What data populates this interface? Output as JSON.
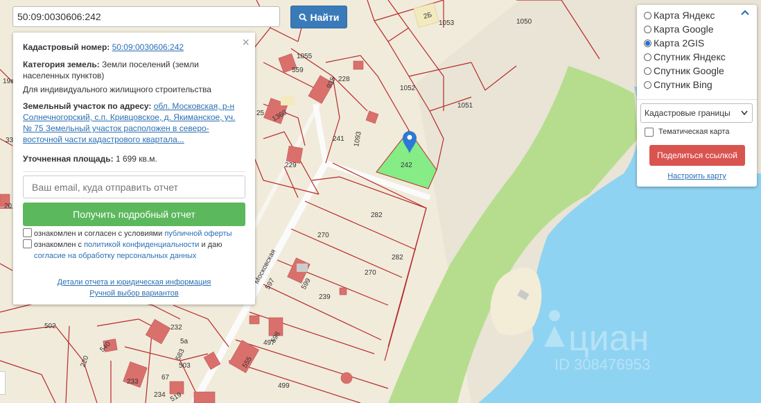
{
  "search": {
    "value": "50:09:0030606:242",
    "button_label": "Найти"
  },
  "info": {
    "cadastral_label": "Кадастровый номер:",
    "cadastral_value": "50:09:0030606:242",
    "category_label": "Категория земель:",
    "category_value": "Земли поселений (земли населенных пунктов)",
    "purpose": "Для индивидуального жилищного строительства",
    "address_label": "Земельный участок по адресу:",
    "address_value": "обл. Московская, р-н Солнечногорский, с.п. Кривцовское, д. Якиманское, уч. № 75 Земельный участок расположен в северо-восточной части кадастрового квартала...",
    "area_label": "Уточненная площадь:",
    "area_value": "1 699 кв.м.",
    "email_placeholder": "Ваш email, куда отправить отчет",
    "report_button": "Получить подробный отчет",
    "consent1_prefix": "ознакомлен и согласен с условиями",
    "consent1_link": "публичной оферты",
    "consent2_prefix": "ознакомлен с",
    "consent2_link1": "политикой конфиденциальности",
    "consent2_mid": "и даю",
    "consent2_link2": "согласие на обработку персональных данных",
    "details_link": "Детали отчета и юридическая информация",
    "manual_link": "Ручной выбор вариантов"
  },
  "layers": {
    "options": [
      {
        "label": "Карта Яндекс",
        "selected": false
      },
      {
        "label": "Карта Google",
        "selected": false
      },
      {
        "label": "Карта 2GIS",
        "selected": true
      },
      {
        "label": "Спутник Яндекс",
        "selected": false
      },
      {
        "label": "Спутник Google",
        "selected": false
      },
      {
        "label": "Спутник Bing",
        "selected": false
      }
    ],
    "overlay_select": "Кадастровые границы",
    "thematic_label": "Тематическая карта",
    "share_button": "Поделиться ссылкой",
    "setup_link": "Настроить карту"
  },
  "map": {
    "street": "Московская",
    "watermark_brand": "циан",
    "watermark_id": "ID 308476953",
    "labels": [
      "2Б",
      "1053",
      "1050",
      "1055",
      "559",
      "228",
      "935",
      "1052",
      "1051",
      "1360",
      "25",
      "241",
      "1093",
      "242",
      "229",
      "282",
      "270",
      "282",
      "270",
      "597",
      "599",
      "239",
      "502",
      "232",
      "5а",
      "497",
      "598",
      "540",
      "220",
      "583",
      "503",
      "555",
      "233",
      "67",
      "234",
      "519",
      "499",
      "19а",
      "33",
      "20"
    ],
    "colors": {
      "parcel_line": "#b52a2a",
      "building": "#d9706c",
      "selected_parcel": "#88ee88",
      "water": "#8fd3f2",
      "park": "#b5dd8c",
      "pin": "#2b79d4"
    }
  }
}
